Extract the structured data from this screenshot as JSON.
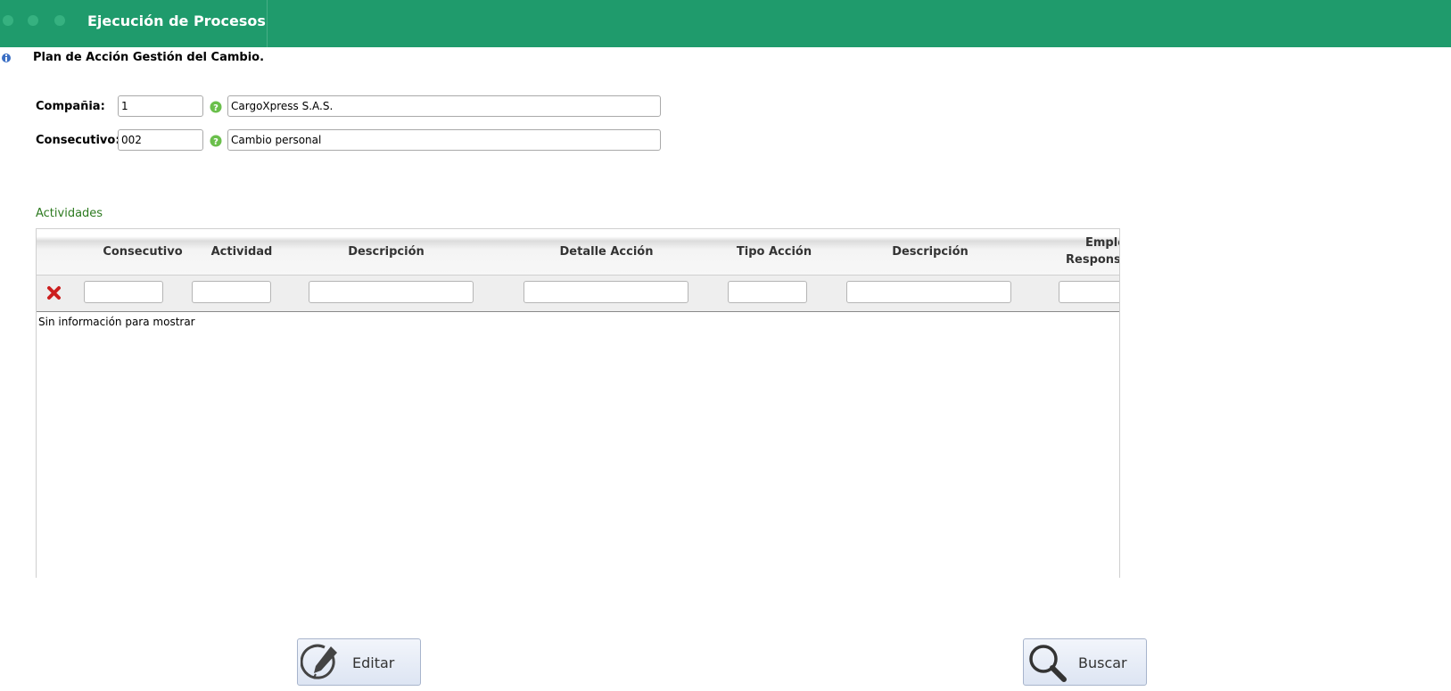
{
  "header": {
    "title": "Ejecución de Procesos"
  },
  "form": {
    "title": "Plan de Acción Gestión del Cambio.",
    "company": {
      "label": "Compañia:",
      "code": "1",
      "name": "CargoXpress S.A.S."
    },
    "consecutive": {
      "label": "Consecutivo:",
      "code": "002",
      "name": "Cambio personal"
    }
  },
  "activities": {
    "title": "Actividades",
    "columns": [
      "Consecutivo",
      "Actividad",
      "Descripción",
      "Detalle Acción",
      "Tipo Acción",
      "Descripción",
      "Empleado Responsable"
    ],
    "columns_visible": [
      "Consecutivo",
      "Actividad",
      "Descripción",
      "Detalle Acción",
      "Tipo Acción",
      "Descripción",
      "Emplead",
      "Responsal"
    ],
    "empty_message": "Sin información para mostrar",
    "rows": []
  },
  "buttons": {
    "edit": "Editar",
    "search": "Buscar"
  },
  "icons": {
    "window_dots": "window-control-dots",
    "info": "info-icon",
    "help": "help-icon",
    "clear_filter": "close-icon",
    "edit": "pencil-icon",
    "search": "search-icon"
  },
  "colors": {
    "header": "#1f9b6c",
    "section_title": "#2c7a1f",
    "clear_filter": "#cc1f1f"
  }
}
